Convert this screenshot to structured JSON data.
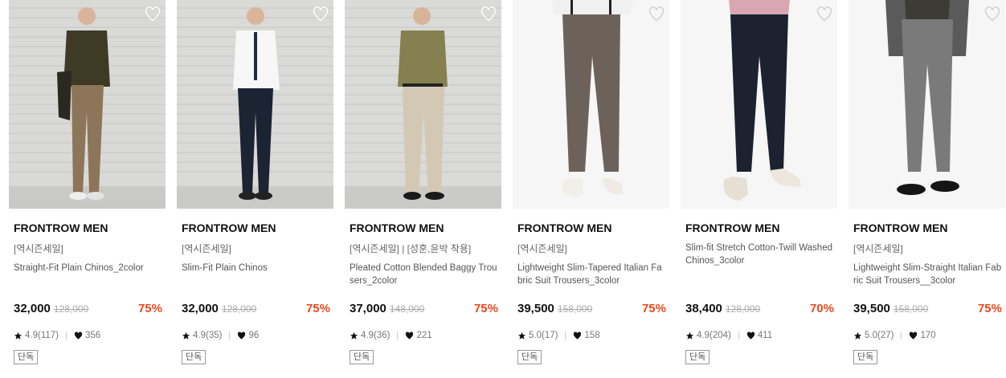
{
  "colors": {
    "discount": "#e8491d",
    "brand_text": "#111111",
    "muted_text": "#666666",
    "strike_price": "#aaaaaa"
  },
  "icons": {
    "wishlist": "heart-outline-icon",
    "rating": "star-icon",
    "likes": "heart-icon"
  },
  "products": [
    {
      "brand": "FRONTROW MEN",
      "tag": "[역시즌세일]",
      "name": "Straight-Fit Plain Chinos_2color",
      "price": "32,000",
      "original_price": "128,000",
      "discount": "75%",
      "rating": "4.9(117)",
      "likes": "356",
      "badge": "단독"
    },
    {
      "brand": "FRONTROW MEN",
      "tag": "[역시즌세일]",
      "name": "Slim-Fit Plain Chinos",
      "price": "32,000",
      "original_price": "128,000",
      "discount": "75%",
      "rating": "4.9(35)",
      "likes": "96",
      "badge": "단독"
    },
    {
      "brand": "FRONTROW MEN",
      "tag": "[역시즌세일] | [성훈,윤박 착용]",
      "name": "Pleated Cotton Blended Baggy Trousers_2color",
      "price": "37,000",
      "original_price": "148,000",
      "discount": "75%",
      "rating": "4.9(36)",
      "likes": "221",
      "badge": "단독"
    },
    {
      "brand": "FRONTROW MEN",
      "tag": "[역시즌세일]",
      "name": "Lightweight Slim-Tapered Italian Fabric Suit Trousers_3color",
      "price": "39,500",
      "original_price": "158,000",
      "discount": "75%",
      "rating": "5.0(17)",
      "likes": "158",
      "badge": "단독"
    },
    {
      "brand": "FRONTROW MEN",
      "tag": "",
      "name": "Slim-fit Stretch Cotton-Twill Washed Chinos_3color",
      "price": "38,400",
      "original_price": "128,000",
      "discount": "70%",
      "rating": "4.9(204)",
      "likes": "411",
      "badge": "단독"
    },
    {
      "brand": "FRONTROW MEN",
      "tag": "[역시즌세일]",
      "name": "Lightweight Slim-Straight Italian Fabric Suit Trousers__3color",
      "price": "39,500",
      "original_price": "158,000",
      "discount": "75%",
      "rating": "5.0(27)",
      "likes": "170",
      "badge": "단독"
    }
  ]
}
